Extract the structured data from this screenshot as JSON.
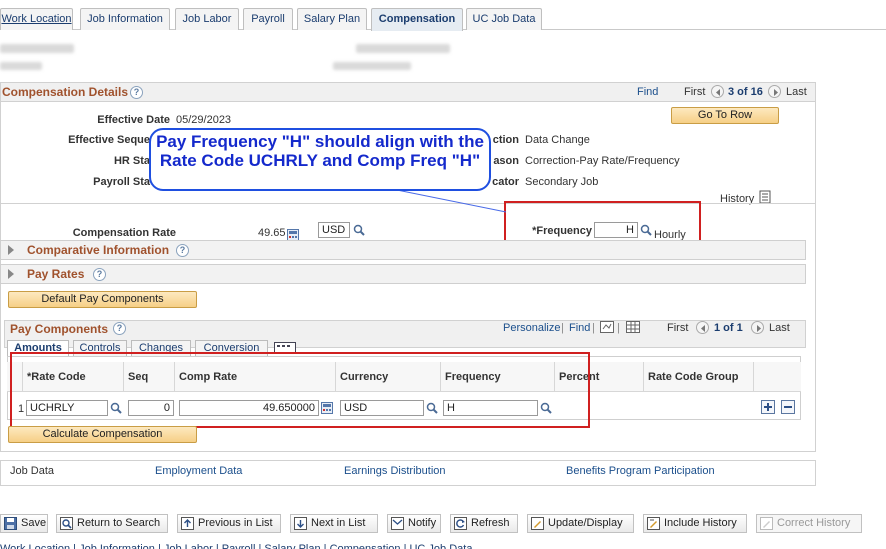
{
  "tabs": [
    {
      "label": "Work Location",
      "active": false
    },
    {
      "label": "Job Information",
      "active": false
    },
    {
      "label": "Job Labor",
      "active": false
    },
    {
      "label": "Payroll",
      "active": false
    },
    {
      "label": "Salary Plan",
      "active": false
    },
    {
      "label": "Compensation",
      "active": true
    },
    {
      "label": "UC Job Data",
      "active": false
    }
  ],
  "comp_details": {
    "title": "Compensation Details",
    "nav": {
      "find": "Find",
      "first": "First",
      "count": "3 of 16",
      "last": "Last"
    },
    "go_to_row": "Go To Row",
    "effective_date_label": "Effective Date",
    "effective_date": "05/29/2023",
    "effective_seq_label": "Effective Seque",
    "hr_status_label": "HR Sta",
    "payroll_status_label": "Payroll Sta",
    "action_label": "ction",
    "action_value": "Data Change",
    "reason_label": "ason",
    "reason_value": "Correction-Pay Rate/Frequency",
    "indicator_label": "cator",
    "indicator_value": "Secondary Job",
    "history_label": "History",
    "comp_rate_label": "Compensation Rate",
    "comp_rate_value": "49.65",
    "currency": "USD",
    "frequency_label": "*Frequency",
    "frequency_value": "H",
    "frequency_desc": "Hourly"
  },
  "callout_text": "Pay Frequency \"H\" should align with the Rate Code UCHRLY and Comp Freq \"H\"",
  "sections": {
    "comparative": "Comparative Information",
    "pay_rates": "Pay Rates",
    "default_pay_btn": "Default Pay Components"
  },
  "pay_components": {
    "title": "Pay Components",
    "toolbar": {
      "personalize": "Personalize",
      "find": "Find",
      "first": "First",
      "count": "1 of 1",
      "last": "Last"
    },
    "subtabs": [
      "Amounts",
      "Controls",
      "Changes",
      "Conversion"
    ],
    "columns": [
      "*Rate Code",
      "Seq",
      "Comp Rate",
      "Currency",
      "Frequency",
      "Percent",
      "Rate Code Group"
    ],
    "row": {
      "num": "1",
      "rate_code": "UCHRLY",
      "seq": "0",
      "comp_rate": "49.650000",
      "currency": "USD",
      "frequency": "H"
    },
    "calc_btn": "Calculate Compensation"
  },
  "footer_links": [
    "Job Data",
    "Employment Data",
    "Earnings Distribution",
    "Benefits Program Participation"
  ],
  "toolbar": [
    "Save",
    "Return to Search",
    "Previous in List",
    "Next in List",
    "Notify",
    "Refresh",
    "Update/Display",
    "Include History",
    "Correct History"
  ],
  "bottom_links": "Work Location | Job Information | Job Labor | Payroll | Salary Plan | Compensation | UC Job Data",
  "colors": {
    "accent_title": "#a0522d",
    "link": "#1b4f8c",
    "highlight_red": "#d02020",
    "callout_blue": "#1429cc"
  }
}
